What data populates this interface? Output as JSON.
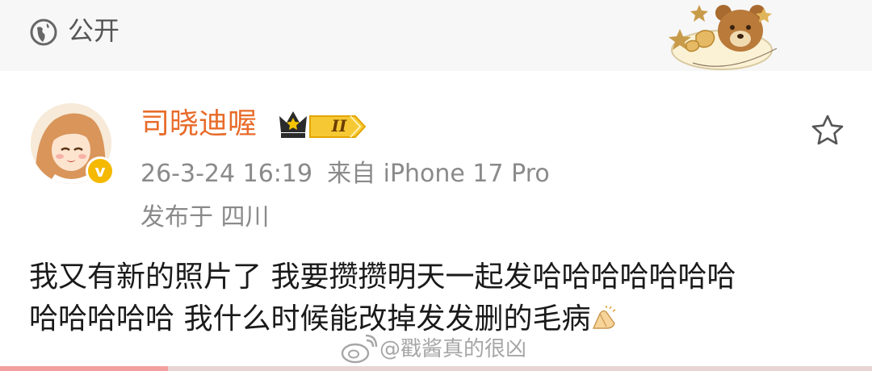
{
  "header": {
    "visibility_icon": "globe-icon",
    "visibility_label": "公开",
    "sticker": "teddy-bear-sticker"
  },
  "author": {
    "name": "司晓迪喔",
    "avatar": "anime-girl-avatar",
    "verified_icon": "verified-v-icon",
    "verified_mark": "v",
    "crown_icon": "crown-icon",
    "level": "II",
    "timestamp": "26-3-24 16:19",
    "source": "来自 iPhone 17 Pro",
    "location": "发布于 四川"
  },
  "actions": {
    "favorite_icon": "star-icon"
  },
  "post": {
    "line1": "我又有新的照片了 我要攒攒明天一起发哈哈哈哈哈哈哈",
    "line2": "哈哈哈哈哈 我什么时候能改掉发发删的毛病",
    "emoji": "praying-hands-emoji"
  },
  "watermark": {
    "text": "@戳酱真的很凶"
  },
  "colors": {
    "author_name": "#e86b2a",
    "meta": "#8a8a8a",
    "badge_gold": "#f5b900"
  }
}
